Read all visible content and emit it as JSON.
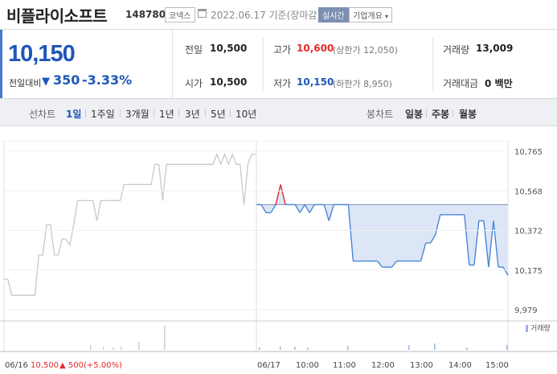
{
  "header": {
    "stock_name": "비플라이소프트",
    "stock_code": "148780",
    "market": "코넥스",
    "date": "2022.06.17 기준(장마감)",
    "realtime_label": "실시간",
    "company_label": "기업개요"
  },
  "price": {
    "current": "10,150",
    "change_label": "전일대비",
    "change_value": "350",
    "change_pct": "-3.33%"
  },
  "stats": {
    "prev_close_label": "전일",
    "prev_close": "10,500",
    "open_label": "시가",
    "open": "10,500",
    "high_label": "고가",
    "high": "10,600",
    "upper_limit": "(상한가 12,050)",
    "low_label": "저가",
    "low": "10,150",
    "lower_limit": "(하한가 8,950)",
    "volume_label": "거래량",
    "volume": "13,009",
    "amount_label": "거래대금",
    "amount": "0 백만"
  },
  "tabs": {
    "line_label": "선차트",
    "line_periods": [
      "1일",
      "1주일",
      "3개월",
      "1년",
      "3년",
      "5년",
      "10년"
    ],
    "candle_label": "봉차트",
    "candle_periods": [
      "일봉",
      "주봉",
      "월봉"
    ]
  },
  "chart_data": {
    "type": "line",
    "y_ticks": [
      "10,765",
      "10,568",
      "10,372",
      "10,175",
      "9,979"
    ],
    "ylim": [
      9979,
      10765
    ],
    "x_labels": [
      "06/16",
      "06/17",
      "10:00",
      "11:00",
      "12:00",
      "13:00",
      "14:00",
      "15:00"
    ],
    "reference_price": 10500,
    "volume_label": "거래량",
    "prev_day_summary": {
      "date": "06/16",
      "close": "10,500",
      "change": "▲ 500",
      "pct": "(+5.00%)"
    },
    "prev_day_series": [
      10130,
      10130,
      10050,
      10050,
      10050,
      10050,
      10050,
      10050,
      10050,
      10250,
      10250,
      10400,
      10400,
      10250,
      10250,
      10330,
      10330,
      10300,
      10400,
      10520,
      10520,
      10520,
      10520,
      10520,
      10420,
      10520,
      10520,
      10520,
      10520,
      10520,
      10520,
      10600,
      10600,
      10600,
      10600,
      10600,
      10600,
      10600,
      10600,
      10700,
      10700,
      10520,
      10700,
      10700,
      10700,
      10700,
      10700,
      10700,
      10700,
      10700,
      10700,
      10700,
      10700,
      10700,
      10700,
      10750,
      10700,
      10750,
      10700,
      10750,
      10700,
      10700,
      10500,
      10700,
      10750,
      10750
    ],
    "today_series": [
      10500,
      10500,
      10460,
      10460,
      10500,
      10600,
      10500,
      10500,
      10500,
      10460,
      10500,
      10460,
      10500,
      10500,
      10500,
      10420,
      10500,
      10500,
      10500,
      10500,
      10220,
      10220,
      10220,
      10220,
      10220,
      10220,
      10190,
      10190,
      10190,
      10220,
      10220,
      10220,
      10220,
      10220,
      10220,
      10310,
      10310,
      10350,
      10450,
      10450,
      10450,
      10450,
      10450,
      10450,
      10200,
      10200,
      10420,
      10420,
      10190,
      10420,
      10190,
      10190,
      10150
    ]
  }
}
